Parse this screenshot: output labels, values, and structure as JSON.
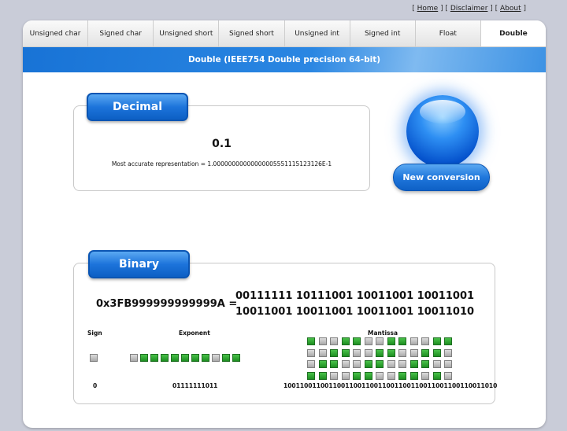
{
  "toplinks": {
    "home": "Home",
    "disclaimer": "Disclaimer",
    "about": "About"
  },
  "tabs": [
    {
      "label": "Unsigned char",
      "active": false
    },
    {
      "label": "Signed char",
      "active": false
    },
    {
      "label": "Unsigned short",
      "active": false
    },
    {
      "label": "Signed short",
      "active": false
    },
    {
      "label": "Unsigned int",
      "active": false
    },
    {
      "label": "Signed int",
      "active": false
    },
    {
      "label": "Float",
      "active": false
    },
    {
      "label": "Double",
      "active": true
    }
  ],
  "banner_title": "Double (IEEE754 Double precision 64-bit)",
  "decimal": {
    "heading": "Decimal",
    "value": "0.1",
    "representation": "Most accurate representation = 1.00000000000000005551115123126E-1"
  },
  "new_conversion_label": "New conversion",
  "binary": {
    "heading": "Binary",
    "hex": "0x3FB999999999999A =",
    "bits_line1": "00111111 10111001 10011001 10011001",
    "bits_line2": "10011001 10011001 10011001 10011010",
    "sign_title": "Sign",
    "exponent_title": "Exponent",
    "mantissa_title": "Mantissa",
    "sign_value": "0",
    "exponent_value": "01111111011",
    "mantissa_value": "1001100110011001100110011001100110011001100110011010"
  },
  "colors": {
    "bit_one": "#2da731",
    "bit_zero": "#bdbdbd",
    "accent": "#1873d6"
  }
}
